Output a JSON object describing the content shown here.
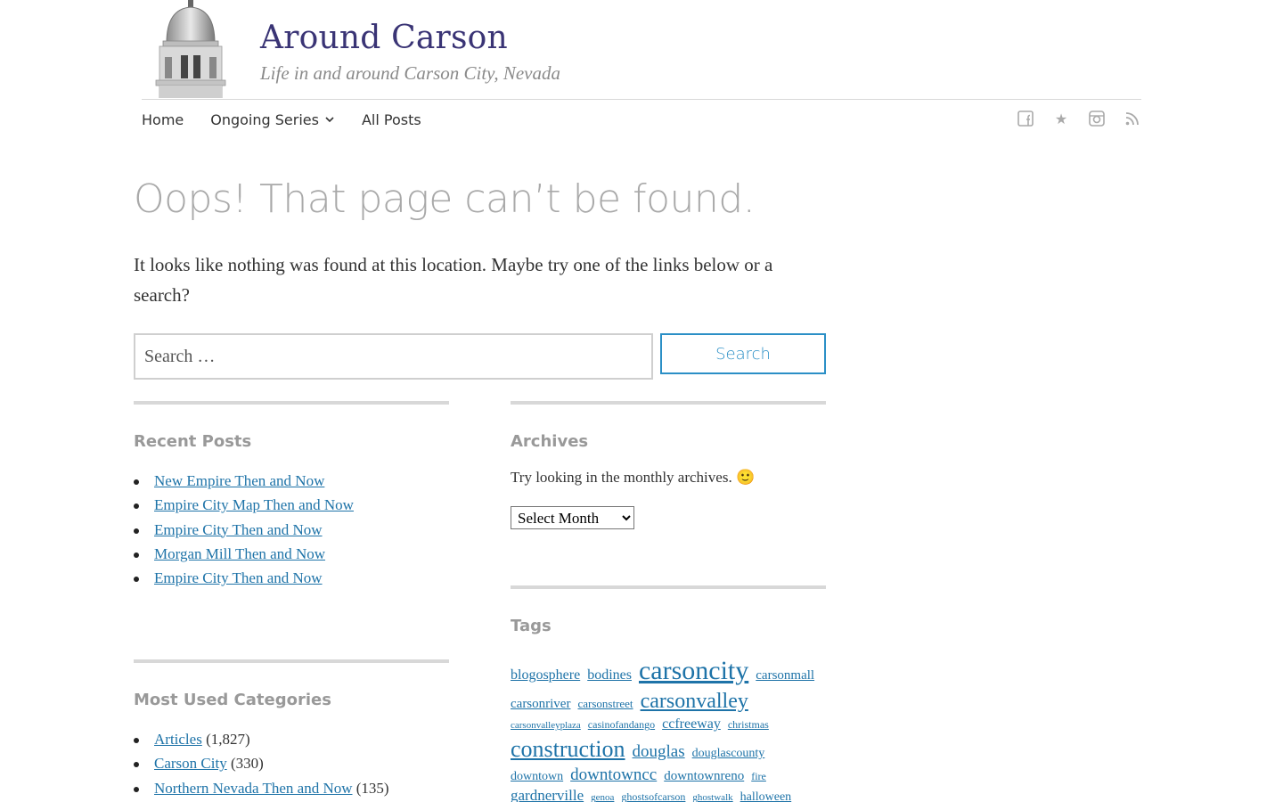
{
  "site": {
    "title": "Around Carson",
    "tagline": "Life in and around Carson City, Nevada"
  },
  "nav": {
    "items": [
      {
        "label": "Home"
      },
      {
        "label": "Ongoing Series"
      },
      {
        "label": "All Posts"
      }
    ]
  },
  "social": {
    "facebook": "facebook-icon",
    "star": "★",
    "instagram": "instagram-icon",
    "rss": "rss-icon"
  },
  "page": {
    "title": "Oops! That page can’t be found.",
    "intro": "It looks like nothing was found at this location. Maybe try one of the links below or a search?"
  },
  "search": {
    "placeholder": "Search …",
    "button": "Search"
  },
  "recent_posts": {
    "title": "Recent Posts",
    "items": [
      "New Empire Then and Now",
      "Empire City Map Then and Now",
      "Empire City Then and Now",
      "Morgan Mill Then and Now",
      "Empire City Then and Now"
    ]
  },
  "archives": {
    "title": "Archives",
    "text": "Try looking in the monthly archives. 🙂",
    "select_value": "Select Month"
  },
  "categories": {
    "title": "Most Used Categories",
    "items": [
      {
        "label": "Articles",
        "count": "(1,827)"
      },
      {
        "label": "Carson City",
        "count": "(330)"
      },
      {
        "label": "Northern Nevada Then and Now",
        "count": "(135)"
      }
    ]
  },
  "tags": {
    "title": "Tags",
    "items": [
      {
        "label": "blogosphere",
        "size": 16
      },
      {
        "label": "bodines",
        "size": 16
      },
      {
        "label": "carsoncity",
        "size": 30
      },
      {
        "label": "carsonmall",
        "size": 15
      },
      {
        "label": "carsonriver",
        "size": 15
      },
      {
        "label": "carsonstreet",
        "size": 13
      },
      {
        "label": "carsonvalley",
        "size": 24
      },
      {
        "label": "carsonvalleyplaza",
        "size": 11
      },
      {
        "label": "casinofandango",
        "size": 12
      },
      {
        "label": "ccfreeway",
        "size": 16
      },
      {
        "label": "christmas",
        "size": 12
      },
      {
        "label": "construction",
        "size": 26
      },
      {
        "label": "douglas",
        "size": 19
      },
      {
        "label": "douglascounty",
        "size": 14
      },
      {
        "label": "downtown",
        "size": 14
      },
      {
        "label": "downtowncc",
        "size": 19
      },
      {
        "label": "downtownreno",
        "size": 15
      },
      {
        "label": "fire",
        "size": 12
      },
      {
        "label": "gardnerville",
        "size": 17
      },
      {
        "label": "genoa",
        "size": 11
      },
      {
        "label": "ghostsofcarson",
        "size": 12
      },
      {
        "label": "ghostwalk",
        "size": 11
      },
      {
        "label": "halloween",
        "size": 14
      }
    ]
  }
}
